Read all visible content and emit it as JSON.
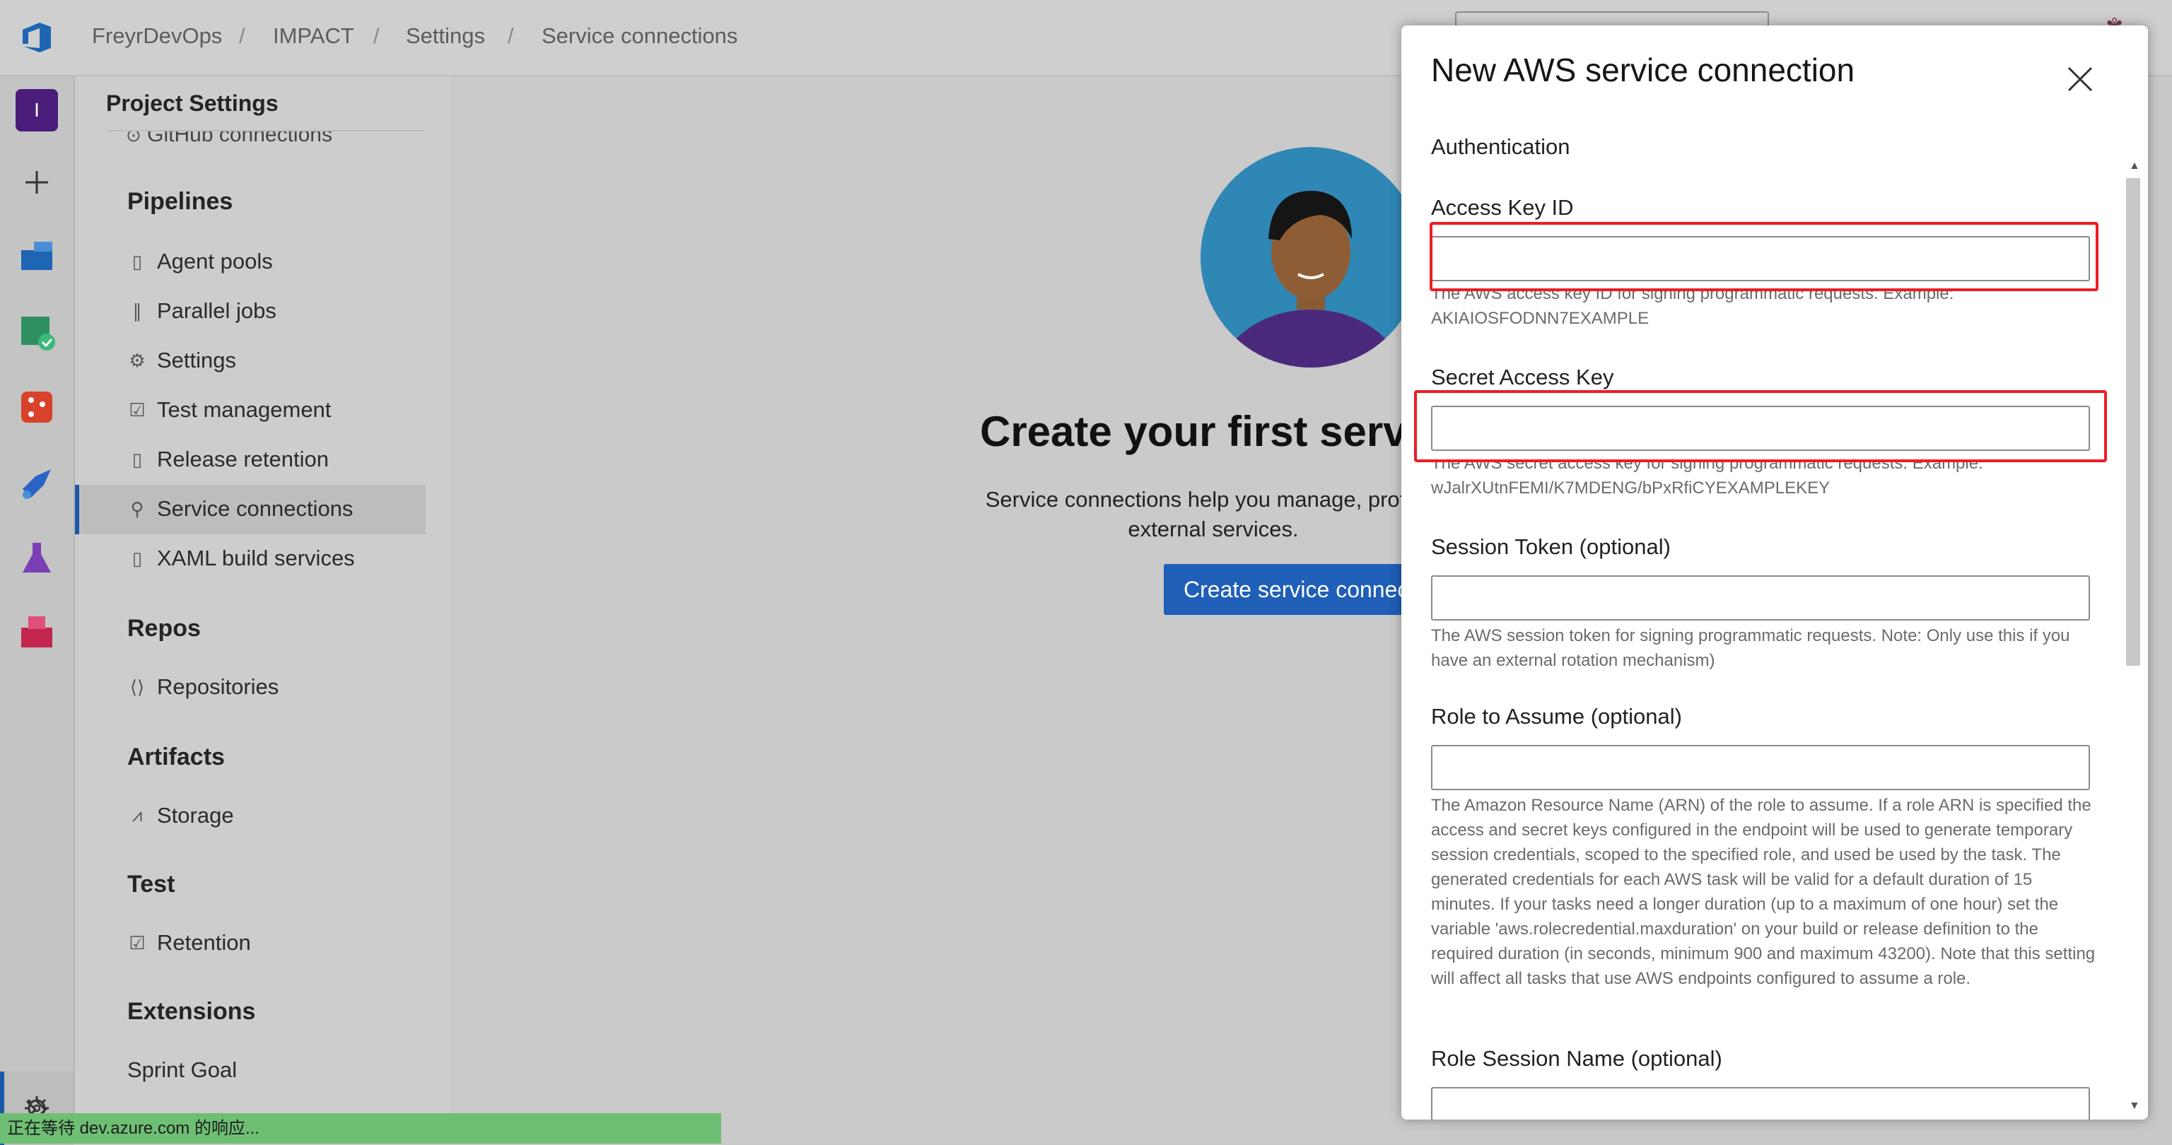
{
  "breadcrumb": [
    "FreyrDevOps",
    "IMPACT",
    "Settings",
    "Service connections"
  ],
  "breadcrumb_separator": "/",
  "rail": {
    "items": [
      {
        "name": "project-avatar",
        "label": "I",
        "color": "#4a1d7a"
      },
      {
        "name": "add-icon",
        "color": "#333333"
      },
      {
        "name": "overview-icon",
        "color": "#1e65b3"
      },
      {
        "name": "boards-icon",
        "color": "#2d8f62"
      },
      {
        "name": "repos-icon",
        "color": "#d8422b"
      },
      {
        "name": "pipelines-icon",
        "color": "#2a63c6"
      },
      {
        "name": "test-plans-icon",
        "color": "#7b3fb6"
      },
      {
        "name": "artifacts-icon",
        "color": "#c2264f"
      }
    ],
    "settings_icon": "gear-icon",
    "expand_icon": "double-chevron-icon"
  },
  "sidebar": {
    "title": "Project Settings",
    "cut_item": "GitHub connections",
    "sections": [
      {
        "heading": "Pipelines",
        "items": [
          {
            "label": "Agent pools",
            "icon": "agent-pool-icon",
            "glyph": "▯"
          },
          {
            "label": "Parallel jobs",
            "icon": "parallel-icon",
            "glyph": "∥"
          },
          {
            "label": "Settings",
            "icon": "gear-icon",
            "glyph": "⚙"
          },
          {
            "label": "Test management",
            "icon": "test-management-icon",
            "glyph": "☑"
          },
          {
            "label": "Release retention",
            "icon": "phone-icon",
            "glyph": "▯"
          },
          {
            "label": "Service connections",
            "icon": "plug-icon",
            "glyph": "⚲"
          },
          {
            "label": "XAML build services",
            "icon": "build-icon",
            "glyph": "▯"
          }
        ]
      },
      {
        "heading": "Repos",
        "items": [
          {
            "label": "Repositories",
            "icon": "repo-icon",
            "glyph": "⟨⟩"
          }
        ]
      },
      {
        "heading": "Artifacts",
        "items": [
          {
            "label": "Storage",
            "icon": "chart-icon",
            "glyph": "⩘"
          }
        ]
      },
      {
        "heading": "Test",
        "items": [
          {
            "label": "Retention",
            "icon": "retention-icon",
            "glyph": "☑"
          }
        ]
      },
      {
        "heading": "Extensions",
        "items": [
          {
            "label": "Sprint Goal",
            "icon": "",
            "glyph": ""
          }
        ]
      }
    ],
    "active_item": "Service connections"
  },
  "main": {
    "title": "Create your first servic",
    "description_line1": "Service connections help you manage, protect,",
    "description_line2": "external services.",
    "button_label": "Create service connect"
  },
  "status_bar": "正在等待 dev.azure.com 的响应...",
  "panel": {
    "title": "New AWS service connection",
    "section": "Authentication",
    "fields": [
      {
        "label": "Access Key ID",
        "value": "",
        "help": "The AWS access key ID for signing programmatic requests. Example: AKIAIOSFODNN7EXAMPLE",
        "highlighted": true
      },
      {
        "label": "Secret Access Key",
        "value": "",
        "help": "The AWS secret access key for signing programmatic requests. Example: wJalrXUtnFEMI/K7MDENG/bPxRfiCYEXAMPLEKEY",
        "highlighted": true
      },
      {
        "label": "Session Token (optional)",
        "value": "",
        "help": "The AWS session token for signing programmatic requests. Note: Only use this if you have an external rotation mechanism)",
        "highlighted": false
      },
      {
        "label": "Role to Assume (optional)",
        "value": "",
        "help": "The Amazon Resource Name (ARN) of the role to assume. If a role ARN is specified the access and secret keys configured in the endpoint will be used to generate temporary session credentials, scoped to the specified role, and used be used by the task. The generated credentials for each AWS task will be valid for a default duration of 15 minutes. If your tasks need a longer duration (up to a maximum of one hour) set the variable 'aws.rolecredential.maxduration' on your build or release definition to the required duration (in seconds, minimum 900 and maximum 43200). Note that this setting will affect all tasks that use AWS endpoints configured to assume a role.",
        "highlighted": false
      },
      {
        "label": "Role Session Name (optional)",
        "value": "",
        "help": "",
        "highlighted": false
      }
    ],
    "highlight_color": "#ef1c25"
  }
}
